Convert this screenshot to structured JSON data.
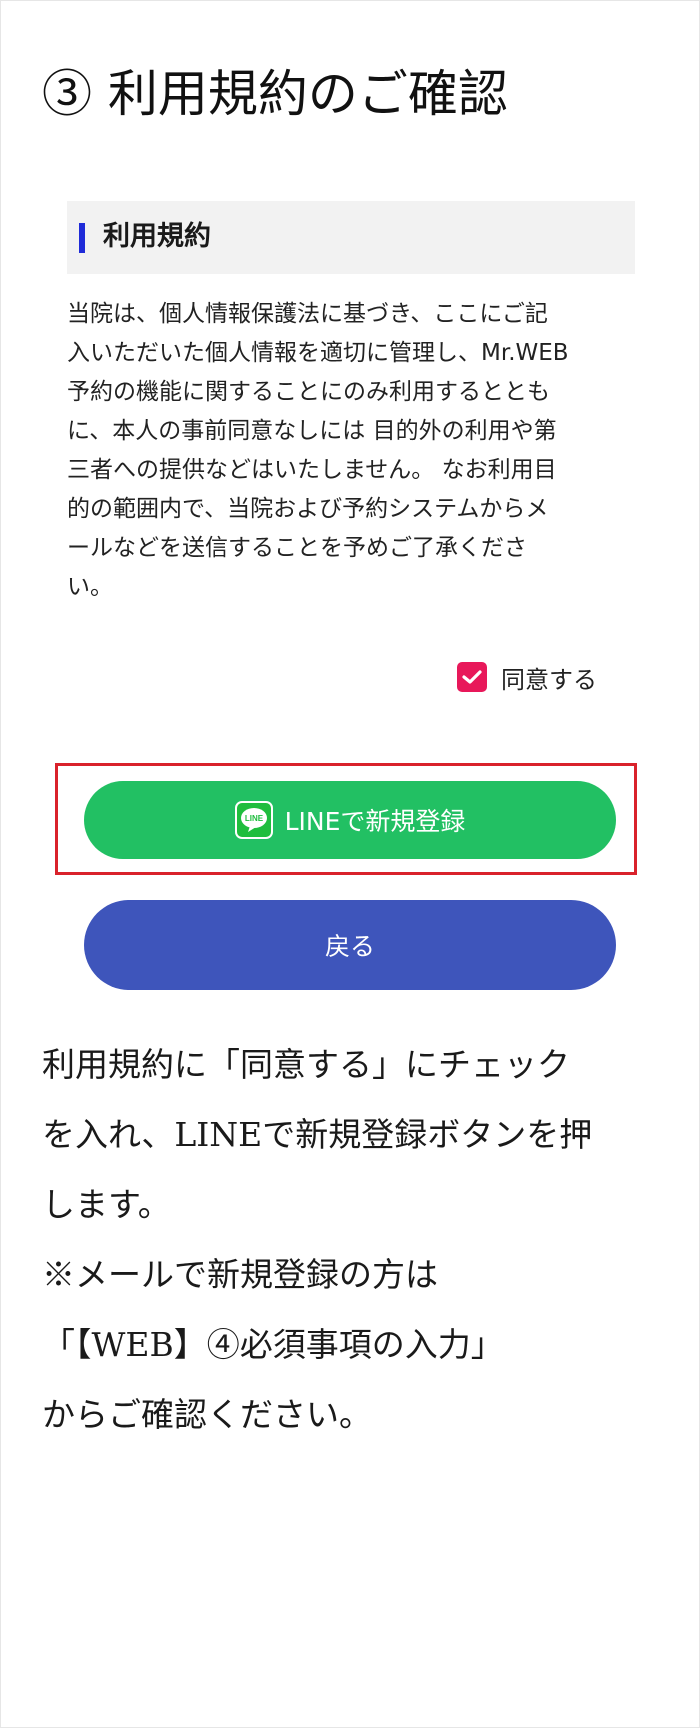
{
  "heading": "③ 利用規約のご確認",
  "terms": {
    "header_title": "利用規約",
    "body_lines": [
      "当院は、個人情報保護法に基づき、ここにご記",
      "入いただいた個人情報を適切に管理し、Mr.WEB",
      "予約の機能に関することにのみ利用するととも",
      "に、本人の事前同意なしには 目的外の利用や第",
      "三者への提供などはいたしません。 なお利用目",
      "的の範囲内で、当院および予約システムからメ",
      "ールなどを送信することを予めご了承くださ",
      "い。"
    ],
    "agree_label": "同意する",
    "agree_checked": true
  },
  "buttons": {
    "line_logo_text": "LINE",
    "line_register": "LINEで新規登録",
    "back": "戻る"
  },
  "instructions": [
    "利用規約に「同意する」にチェック",
    "を入れ、LINEで新規登録ボタンを押",
    "します。",
    "※メールで新規登録の方は",
    "「【WEB】④必須事項の入力」",
    "からご確認ください。"
  ],
  "colors": {
    "accent_bar": "#1f2bd8",
    "checkbox": "#e8185a",
    "line_button": "#22c063",
    "back_button": "#3e55bb",
    "highlight": "#d9222b"
  },
  "icons": {
    "checkbox": "check-icon",
    "line": "line-logo-icon"
  }
}
